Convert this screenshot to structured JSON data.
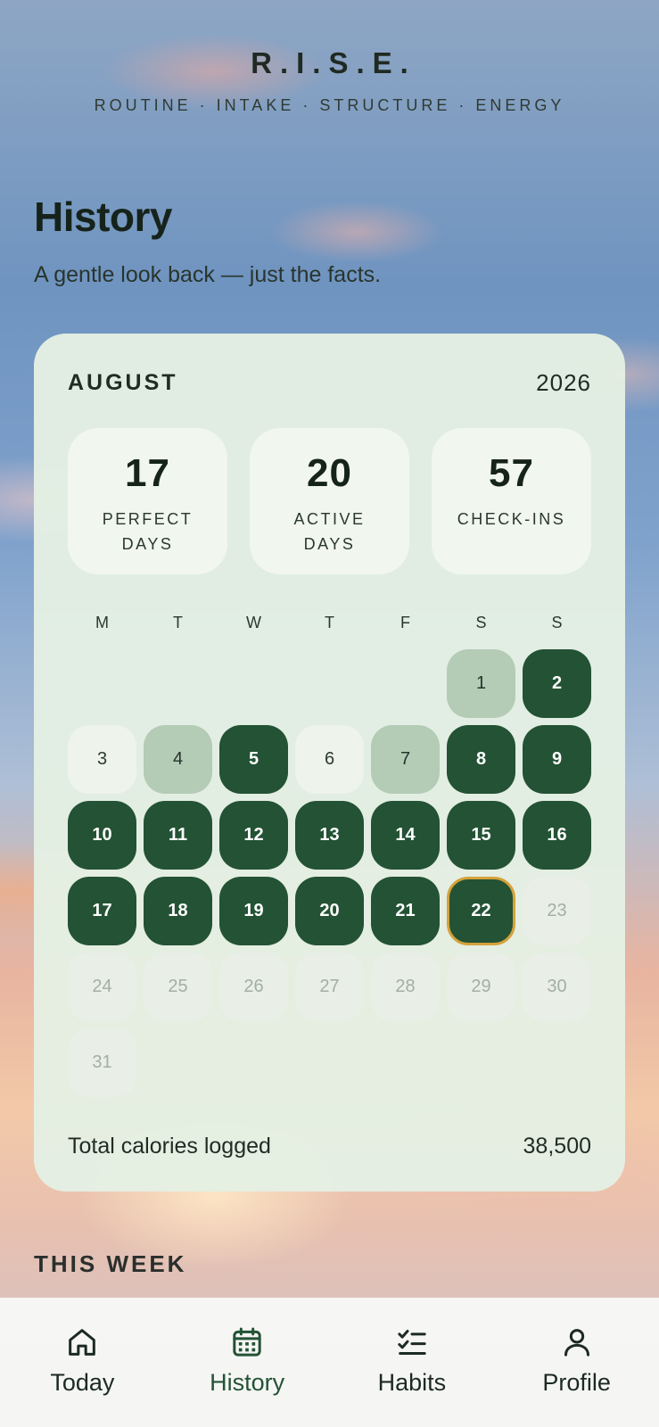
{
  "brand": {
    "title": "R.I.S.E.",
    "subtitle": "ROUTINE · INTAKE · STRUCTURE · ENERGY"
  },
  "page": {
    "title": "History",
    "subtitle": "A gentle look back — just the facts."
  },
  "calendar": {
    "month": "AUGUST",
    "year": "2026",
    "stats": [
      {
        "value": "17",
        "label": "PERFECT DAYS"
      },
      {
        "value": "20",
        "label": "ACTIVE DAYS"
      },
      {
        "value": "57",
        "label": "CHECK-INS"
      }
    ],
    "weekdays": [
      "M",
      "T",
      "W",
      "T",
      "F",
      "S",
      "S"
    ],
    "leading_blanks": 5,
    "days": [
      {
        "d": "1",
        "s": "partial"
      },
      {
        "d": "2",
        "s": "perfect"
      },
      {
        "d": "3",
        "s": "empty"
      },
      {
        "d": "4",
        "s": "partial"
      },
      {
        "d": "5",
        "s": "perfect"
      },
      {
        "d": "6",
        "s": "empty"
      },
      {
        "d": "7",
        "s": "partial"
      },
      {
        "d": "8",
        "s": "perfect"
      },
      {
        "d": "9",
        "s": "perfect"
      },
      {
        "d": "10",
        "s": "perfect"
      },
      {
        "d": "11",
        "s": "perfect"
      },
      {
        "d": "12",
        "s": "perfect"
      },
      {
        "d": "13",
        "s": "perfect"
      },
      {
        "d": "14",
        "s": "perfect"
      },
      {
        "d": "15",
        "s": "perfect"
      },
      {
        "d": "16",
        "s": "perfect"
      },
      {
        "d": "17",
        "s": "perfect"
      },
      {
        "d": "18",
        "s": "perfect"
      },
      {
        "d": "19",
        "s": "perfect"
      },
      {
        "d": "20",
        "s": "perfect"
      },
      {
        "d": "21",
        "s": "perfect"
      },
      {
        "d": "22",
        "s": "perfect",
        "today": true
      },
      {
        "d": "23",
        "s": "future"
      },
      {
        "d": "24",
        "s": "future"
      },
      {
        "d": "25",
        "s": "future"
      },
      {
        "d": "26",
        "s": "future"
      },
      {
        "d": "27",
        "s": "future"
      },
      {
        "d": "28",
        "s": "future"
      },
      {
        "d": "29",
        "s": "future"
      },
      {
        "d": "30",
        "s": "future"
      },
      {
        "d": "31",
        "s": "future"
      }
    ],
    "total_label": "Total calories logged",
    "total_value": "38,500"
  },
  "section": {
    "this_week": "THIS WEEK"
  },
  "colors": {
    "perfect": "#235234",
    "partial": "#b4cbb6",
    "today_ring": "#d4a23a",
    "card": "#e4efe3"
  },
  "nav": {
    "items": [
      {
        "label": "Today",
        "icon": "home-icon",
        "active": false
      },
      {
        "label": "History",
        "icon": "calendar-icon",
        "active": true
      },
      {
        "label": "Habits",
        "icon": "checklist-icon",
        "active": false
      },
      {
        "label": "Profile",
        "icon": "person-icon",
        "active": false
      }
    ]
  }
}
